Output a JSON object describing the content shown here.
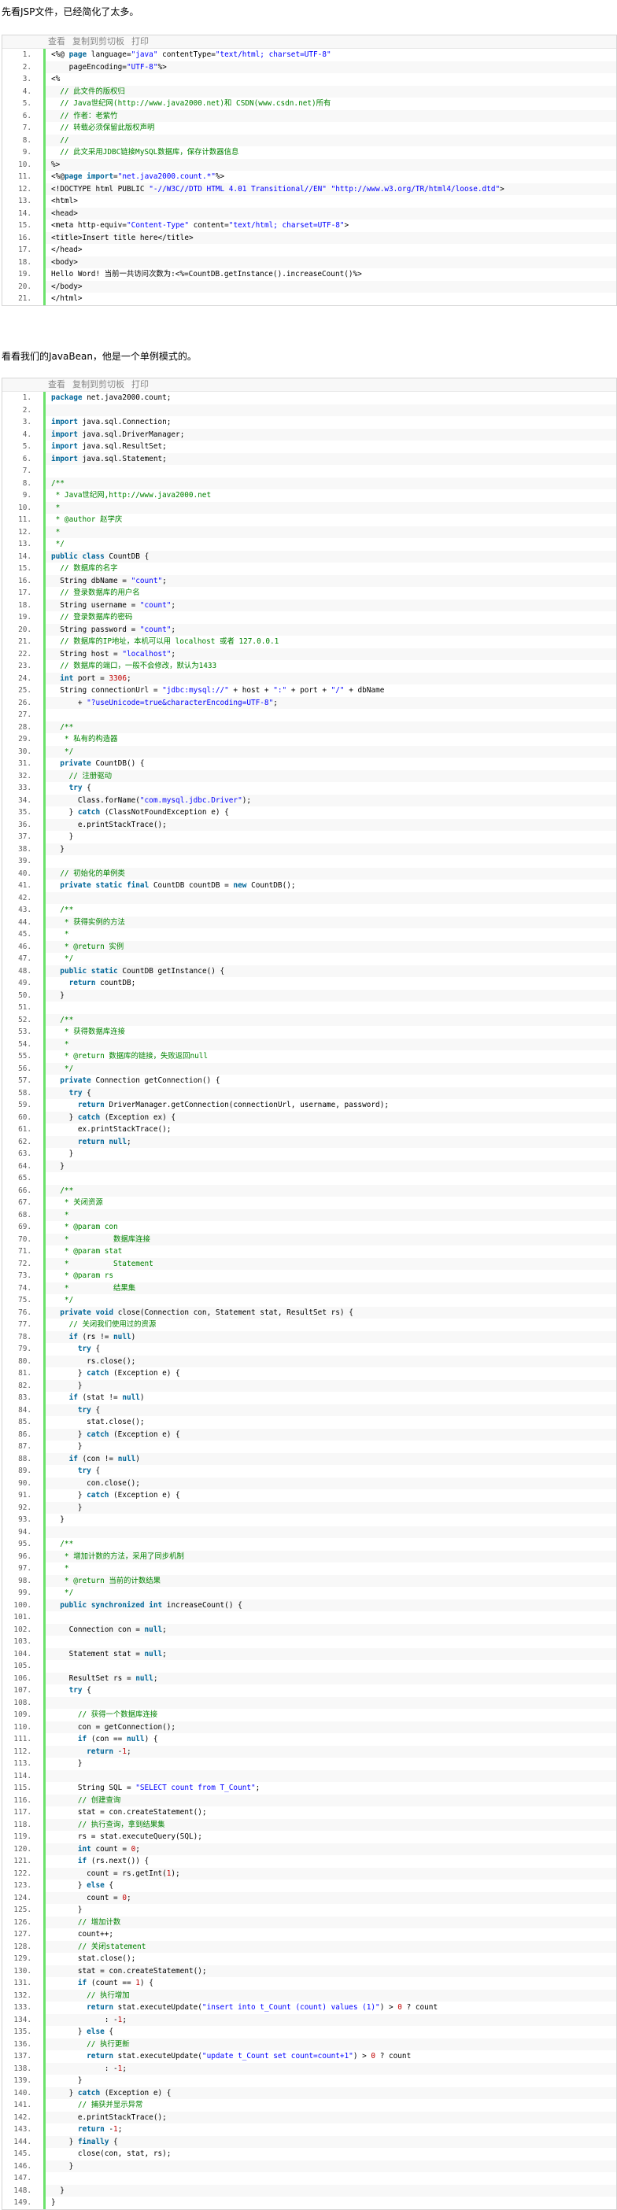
{
  "intro1": "先看JSP文件，已经简化了太多。",
  "intro2": "看看我们的JavaBean，他是一个单例模式的。",
  "toolbar": {
    "view": "查看",
    "copy": "复制到剪切板",
    "print": "打印"
  },
  "jsp_lines": [
    "<%@ page language=\"java\" contentType=\"text/html; charset=UTF-8\"",
    "    pageEncoding=\"UTF-8\"%>",
    "<%",
    "  // 此文件的版权归",
    "  // Java世纪网(http://www.java2000.net)和 CSDN(www.csdn.net)所有",
    "  // 作者：老紫竹",
    "  // 转载必须保留此版权声明",
    "  //",
    "  // 此文采用JDBC链接MySQL数据库，保存计数器信息",
    "%>",
    "<%@page import=\"net.java2000.count.*\"%>",
    "<!DOCTYPE html PUBLIC \"-//W3C//DTD HTML 4.01 Transitional//EN\" \"http://www.w3.org/TR/html4/loose.dtd\">",
    "<html>",
    "<head>",
    "<meta http-equiv=\"Content-Type\" content=\"text/html; charset=UTF-8\">",
    "<title>Insert title here</title>",
    "</head>",
    "<body>",
    "Hello Word! 当前一共访问次数为:<%=CountDB.getInstance().increaseCount()%>",
    "</body>",
    "</html>"
  ],
  "java_lines": [
    "package net.java2000.count;",
    "",
    "import java.sql.Connection;",
    "import java.sql.DriverManager;",
    "import java.sql.ResultSet;",
    "import java.sql.Statement;",
    "",
    "/**",
    " * Java世纪网,http://www.java2000.net",
    " *",
    " * @author 赵学庆",
    " *",
    " */",
    "public class CountDB {",
    "  // 数据库的名字",
    "  String dbName = \"count\";",
    "  // 登录数据库的用户名",
    "  String username = \"count\";",
    "  // 登录数据库的密码",
    "  String password = \"count\";",
    "  // 数据库的IP地址，本机可以用 localhost 或者 127.0.0.1",
    "  String host = \"localhost\";",
    "  // 数据库的端口，一般不会修改，默认为1433",
    "  int port = 3306;",
    "  String connectionUrl = \"jdbc:mysql://\" + host + \":\" + port + \"/\" + dbName",
    "      + \"?useUnicode=true&characterEncoding=UTF-8\";",
    "",
    "  /**",
    "   * 私有的构造器",
    "   */",
    "  private CountDB() {",
    "    // 注册驱动",
    "    try {",
    "      Class.forName(\"com.mysql.jdbc.Driver\");",
    "    } catch (ClassNotFoundException e) {",
    "      e.printStackTrace();",
    "    }",
    "  }",
    "",
    "  // 初始化的单例类",
    "  private static final CountDB countDB = new CountDB();",
    "",
    "  /**",
    "   * 获得实例的方法",
    "   *",
    "   * @return 实例",
    "   */",
    "  public static CountDB getInstance() {",
    "    return countDB;",
    "  }",
    "",
    "  /**",
    "   * 获得数据库连接",
    "   *",
    "   * @return 数据库的链接，失败返回null",
    "   */",
    "  private Connection getConnection() {",
    "    try {",
    "      return DriverManager.getConnection(connectionUrl, username, password);",
    "    } catch (Exception ex) {",
    "      ex.printStackTrace();",
    "      return null;",
    "    }",
    "  }",
    "",
    "  /**",
    "   * 关闭资源",
    "   *",
    "   * @param con",
    "   *          数据库连接",
    "   * @param stat",
    "   *          Statement",
    "   * @param rs",
    "   *          结果集",
    "   */",
    "  private void close(Connection con, Statement stat, ResultSet rs) {",
    "    // 关闭我们使用过的资源",
    "    if (rs != null)",
    "      try {",
    "        rs.close();",
    "      } catch (Exception e) {",
    "      }",
    "    if (stat != null)",
    "      try {",
    "        stat.close();",
    "      } catch (Exception e) {",
    "      }",
    "    if (con != null)",
    "      try {",
    "        con.close();",
    "      } catch (Exception e) {",
    "      }",
    "  }",
    "",
    "  /**",
    "   * 增加计数的方法，采用了同步机制",
    "   *",
    "   * @return 当前的计数结果",
    "   */",
    "  public synchronized int increaseCount() {",
    "",
    "    Connection con = null;",
    "",
    "    Statement stat = null;",
    "",
    "    ResultSet rs = null;",
    "    try {",
    "",
    "      // 获得一个数据库连接",
    "      con = getConnection();",
    "      if (con == null) {",
    "        return -1;",
    "      }",
    "",
    "      String SQL = \"SELECT count from T_Count\";",
    "      // 创建查询",
    "      stat = con.createStatement();",
    "      // 执行查询，拿到结果集",
    "      rs = stat.executeQuery(SQL);",
    "      int count = 0;",
    "      if (rs.next()) {",
    "        count = rs.getInt(1);",
    "      } else {",
    "        count = 0;",
    "      }",
    "      // 增加计数",
    "      count++;",
    "      // 关闭statement",
    "      stat.close();",
    "      stat = con.createStatement();",
    "      if (count == 1) {",
    "        // 执行增加",
    "        return stat.executeUpdate(\"insert into t_Count (count) values (1)\") > 0 ? count",
    "            : -1;",
    "      } else {",
    "        // 执行更新",
    "        return stat.executeUpdate(\"update t_Count set count=count+1\") > 0 ? count",
    "            : -1;",
    "      }",
    "    } catch (Exception e) {",
    "      // 捕获并显示异常",
    "      e.printStackTrace();",
    "      return -1;",
    "    } finally {",
    "      close(con, stat, rs);",
    "    }",
    "",
    "  }",
    "}"
  ]
}
